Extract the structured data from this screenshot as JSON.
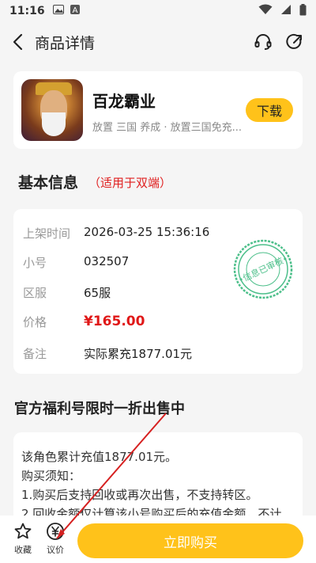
{
  "status_bar": {
    "time": "11:16"
  },
  "header": {
    "title": "商品详情"
  },
  "game": {
    "name": "百龙霸业",
    "tags": "放置 三国 养成 · 放置三国免充...",
    "download_label": "下载"
  },
  "basic_info": {
    "title": "基本信息",
    "note": "（适用于双端）",
    "rows": [
      {
        "label": "上架时间",
        "value": "2026-03-25 15:36:16"
      },
      {
        "label": "小号",
        "value": "032507"
      },
      {
        "label": "区服",
        "value": "65服"
      },
      {
        "label": "价格",
        "value": "¥165.00"
      },
      {
        "label": "备注",
        "value": "实际累充1877.01元"
      }
    ],
    "stamp_text": "•信息已审核•"
  },
  "promo": {
    "title": "官方福利号限时一折出售中",
    "lines": [
      "该角色累计充值1877.01元。",
      "购买须知：",
      "1.购买后支持回收或再次出售，不支持转区。",
      "2.回收金额仅计算该小号购买后的充值金额，不计"
    ]
  },
  "bottom_bar": {
    "favorite_label": "收藏",
    "bargain_label": "议价",
    "buy_label": "立即购买"
  },
  "colors": {
    "accent": "#ffc21a",
    "price": "#e01818",
    "stamp": "#4cbf8a"
  }
}
